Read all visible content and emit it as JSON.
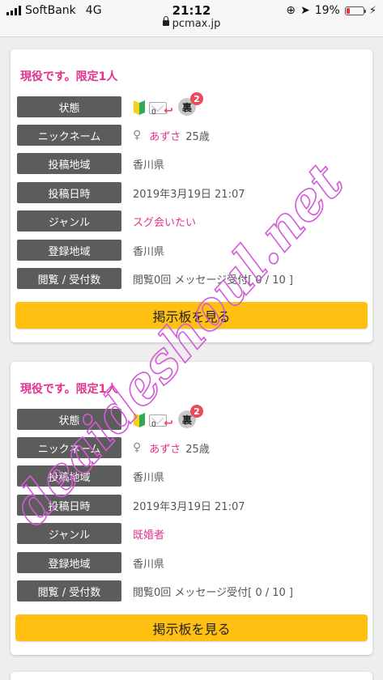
{
  "status_bar": {
    "carrier": "SoftBank",
    "network": "4G",
    "time": "21:12",
    "url": "pcmax.jp",
    "battery": "19%",
    "battery_level": 0.19
  },
  "cards": [
    {
      "title": "現役です。限定1人",
      "labels": {
        "status": "状態",
        "nickname": "ニックネーム",
        "region": "投稿地域",
        "datetime": "投稿日時",
        "genre": "ジャンル",
        "reg_region": "登録地域",
        "views": "閲覧 / 受付数"
      },
      "status_icons": {
        "mail_count": "0",
        "ura_label": "裏",
        "ura_badge": "2"
      },
      "gender": "♀",
      "nickname": "あずさ",
      "age": "25歳",
      "region": "香川県",
      "datetime": "2019年3月19日 21:07",
      "genre": "スグ会いたい",
      "reg_region": "香川県",
      "views": "閲覧0回 メッセージ受付[ 0 / 10 ]",
      "button": "掲示板を見る"
    },
    {
      "title": "現役です。限定1人",
      "labels": {
        "status": "状態",
        "nickname": "ニックネーム",
        "region": "投稿地域",
        "datetime": "投稿日時",
        "genre": "ジャンル",
        "reg_region": "登録地域",
        "views": "閲覧 / 受付数"
      },
      "status_icons": {
        "mail_count": "0",
        "ura_label": "裏",
        "ura_badge": "2"
      },
      "gender": "♀",
      "nickname": "あずさ",
      "age": "25歳",
      "region": "香川県",
      "datetime": "2019年3月19日 21:07",
      "genre": "既婚者",
      "reg_region": "香川県",
      "views": "閲覧0回 メッセージ受付[ 0 / 10 ]",
      "button": "掲示板を見る"
    }
  ],
  "watermark": "deaideshoul.net",
  "colors": {
    "accent": "#e4318f",
    "button": "#ffc012",
    "label_bg": "#5c5c5c"
  }
}
